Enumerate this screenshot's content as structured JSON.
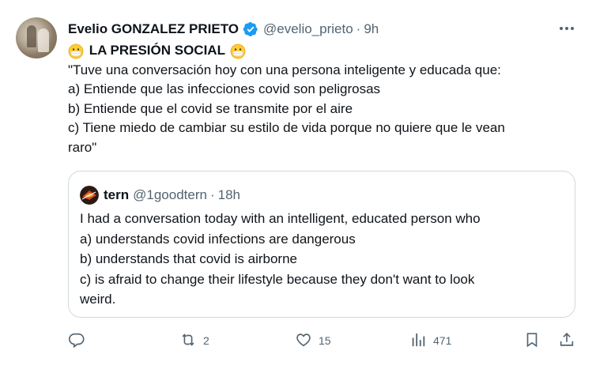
{
  "tweet": {
    "author_name": "Evelio GONZALEZ PRIETO",
    "handle": "@evelio_prieto",
    "separator": "·",
    "time": "9h",
    "title": "LA PRESIÓN SOCIAL",
    "lines": [
      "\"Tuve una conversación hoy con una persona inteligente y educada que:",
      "a) Entiende que las infecciones covid son peligrosas",
      "b) Entiende que el covid se transmite por el aire",
      "c) Tiene miedo de cambiar su estilo de vida porque no quiere que le vean",
      "raro\""
    ]
  },
  "quoted": {
    "author_name": "tern",
    "handle": "@1goodtern",
    "separator": "·",
    "time": "18h",
    "lines": [
      "I had a conversation today with an intelligent, educated person who",
      "a) understands covid infections are dangerous",
      "b) understands that covid is airborne",
      "c) is afraid to change their lifestyle because they don't want to look",
      "weird."
    ]
  },
  "actions": {
    "reply_count": "",
    "retweet_count": "2",
    "like_count": "15",
    "views_count": "471"
  },
  "icons": {
    "more": "more-horizontal-icon",
    "verified": "verified-badge-icon",
    "emoji": "mask-face-emoji",
    "reply": "reply-icon",
    "retweet": "retweet-icon",
    "like": "heart-icon",
    "views": "views-chart-icon",
    "bookmark": "bookmark-icon",
    "share": "share-icon"
  },
  "colors": {
    "text": "#0f1419",
    "secondary": "#536471",
    "verified": "#1d9bf0",
    "border": "#cfd9de"
  }
}
